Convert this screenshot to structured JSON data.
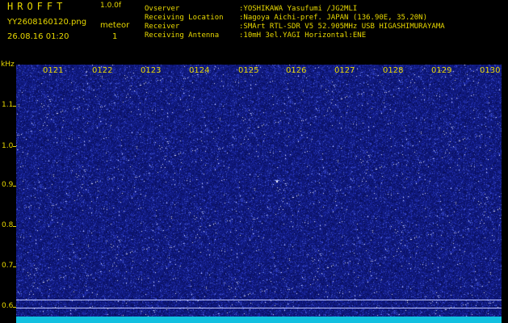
{
  "header": {
    "logo": "HROFFT",
    "version": "1.0.0f",
    "filename": "YY2608160120.png",
    "datetime": "26.08.16 01:20",
    "meteor_label": "meteor",
    "meteor_count": "1",
    "info": [
      {
        "label": "Ovserver",
        "value": ":YOSHIKAWA Yasufumi /JG2MLI"
      },
      {
        "label": "Receiving Location",
        "value": ":Nagoya Aichi-pref. JAPAN (136.90E, 35.20N)"
      },
      {
        "label": "Receiver",
        "value": ":SMArt RTL-SDR V5 52.905MHz USB HIGASHIMURAYAMA"
      },
      {
        "label": "Receiving Antenna",
        "value": ":10mH 3el.YAGI Horizontal:ENE"
      }
    ]
  },
  "axes": {
    "y_unit": "kHz",
    "y_ticks": [
      "1.1",
      "1.0",
      "0.9",
      "0.8",
      "0.7",
      "0.6"
    ],
    "x_ticks": [
      "0121",
      "0122",
      "0123",
      "0124",
      "0125",
      "0126",
      "0127",
      "0128",
      "0129",
      "0130"
    ]
  },
  "colors": {
    "background": "#101a80",
    "text": "#e8d800",
    "band": "#11c0e0"
  }
}
